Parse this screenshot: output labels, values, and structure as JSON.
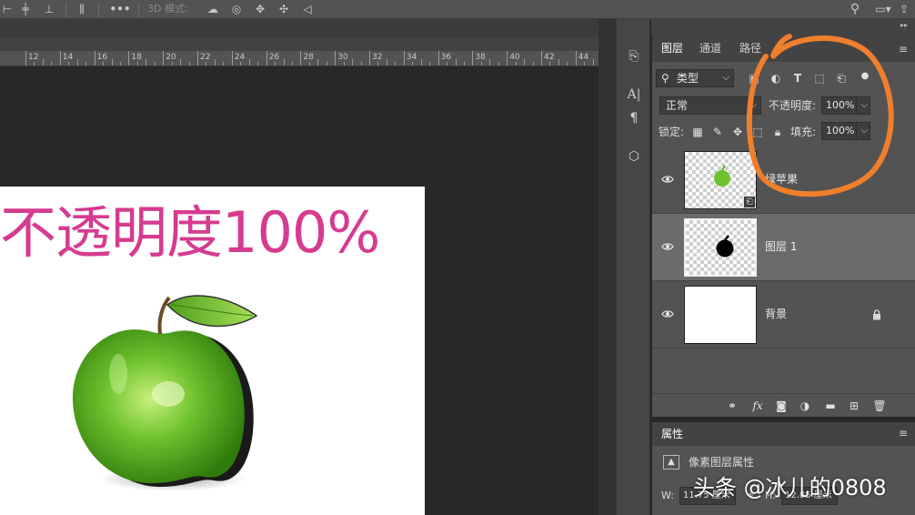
{
  "options_bar": {
    "mode_3d_label": "3D 模式:",
    "more_label": "•••"
  },
  "ruler": {
    "labels": [
      "12",
      "14",
      "16",
      "18",
      "20",
      "22",
      "24",
      "26",
      "28",
      "30",
      "32",
      "34",
      "36",
      "38",
      "40",
      "42",
      "44"
    ]
  },
  "document": {
    "overlay_text": "不透明度100%",
    "image_subject": "green-apple"
  },
  "layers_panel": {
    "tabs": [
      {
        "label": "图层",
        "active": true
      },
      {
        "label": "通道",
        "active": false
      },
      {
        "label": "路径",
        "active": false
      }
    ],
    "filter": {
      "label": "类型"
    },
    "blend_mode": {
      "value": "正常"
    },
    "opacity": {
      "label": "不透明度:",
      "value": "100%"
    },
    "lock": {
      "label": "锁定:"
    },
    "fill": {
      "label": "填充:",
      "value": "100%"
    },
    "layers": [
      {
        "name": "绿苹果",
        "selected": false,
        "smart_object": true,
        "locked": false
      },
      {
        "name": "图层 1",
        "selected": true,
        "smart_object": false,
        "locked": false
      },
      {
        "name": "背景",
        "selected": false,
        "smart_object": false,
        "locked": true
      }
    ]
  },
  "properties_panel": {
    "title": "属性",
    "subtitle": "像素图层属性",
    "w_label": "W:",
    "w_value": "11.75 厘米",
    "h_label": "H:",
    "h_value": "12.85 厘米"
  },
  "watermark": {
    "text": "头条 @冰儿的0808"
  },
  "colors": {
    "annotation_circle": "#f07f2c",
    "overlay_text": "#d63b8f",
    "apple_green": "#6cc12c"
  }
}
